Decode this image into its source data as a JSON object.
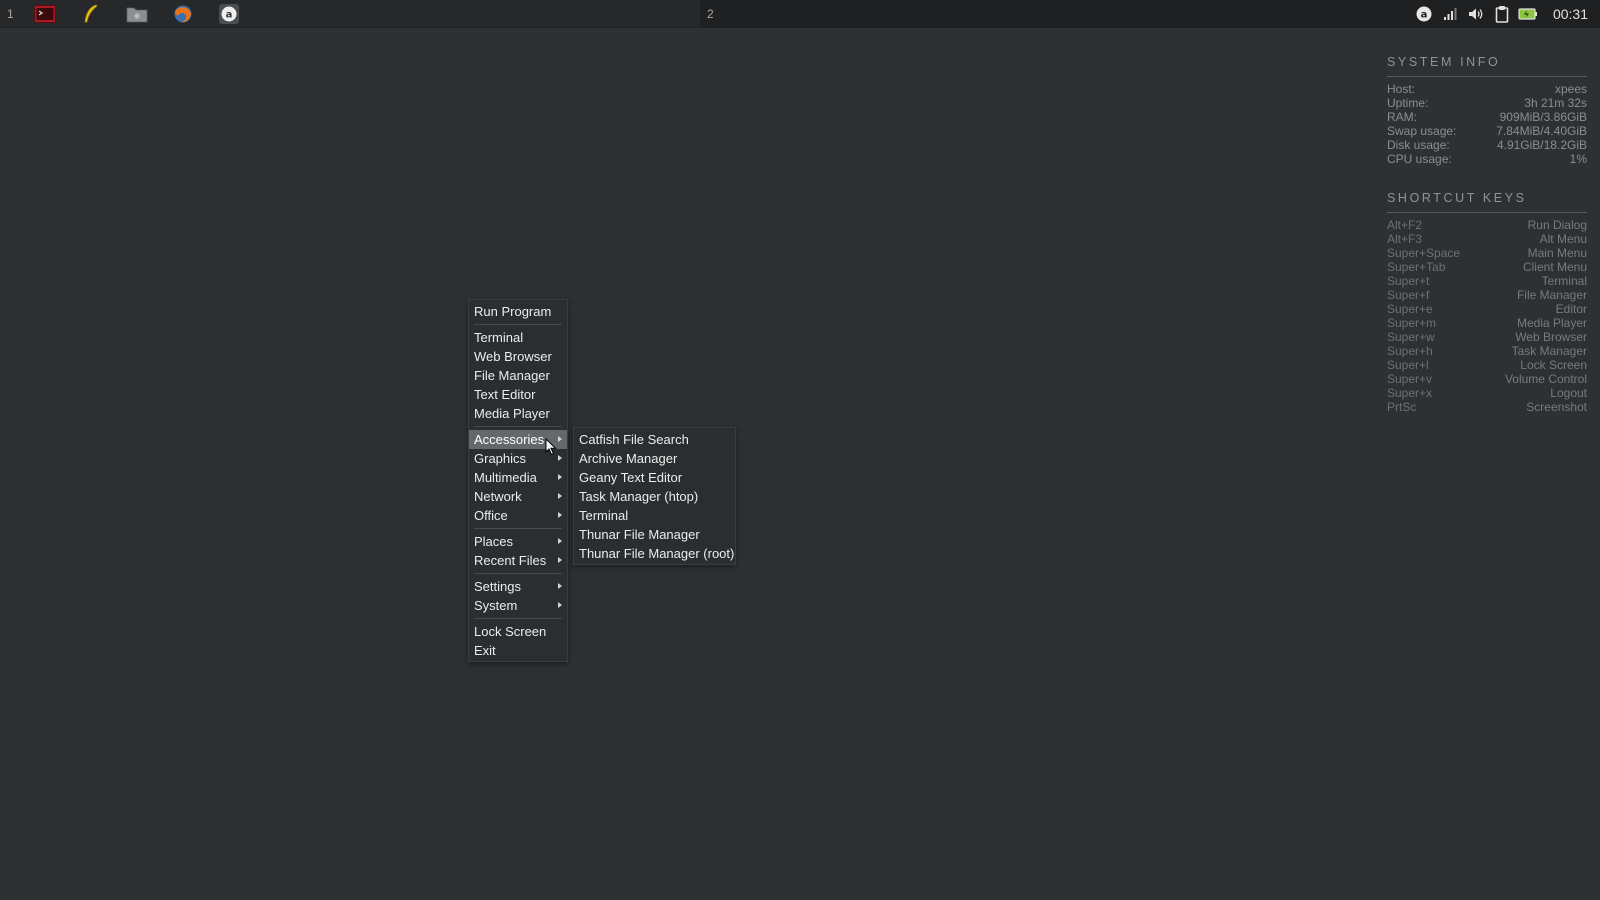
{
  "panel": {
    "workspace_1": "1",
    "workspace_2": "2",
    "launchers": [
      {
        "name": "terminal-launcher",
        "icon": "terminal-icon"
      },
      {
        "name": "editor-launcher",
        "icon": "feather-icon"
      },
      {
        "name": "file-manager-launcher",
        "icon": "folder-icon"
      },
      {
        "name": "browser-launcher",
        "icon": "firefox-icon"
      },
      {
        "name": "app-launcher",
        "icon": "circle-a-icon"
      }
    ],
    "tray": [
      "circle-a-icon",
      "signal-icon",
      "volume-icon",
      "clipboard-icon",
      "battery-icon"
    ],
    "clock": "00:31"
  },
  "conky": {
    "system_title": "SYSTEM INFO",
    "system": [
      {
        "label": "Host:",
        "value": "xpees"
      },
      {
        "label": "Uptime:",
        "value": "3h 21m 32s"
      },
      {
        "label": "RAM:",
        "value": "909MiB/3.86GiB"
      },
      {
        "label": "Swap usage:",
        "value": "7.84MiB/4.40GiB"
      },
      {
        "label": "Disk usage:",
        "value": "4.91GiB/18.2GiB"
      },
      {
        "label": "CPU usage:",
        "value": "1%"
      }
    ],
    "keys_title": "SHORTCUT KEYS",
    "keys": [
      {
        "key": "Alt+F2",
        "action": "Run Dialog"
      },
      {
        "key": "Alt+F3",
        "action": "Alt Menu"
      },
      {
        "key": "Super+Space",
        "action": "Main Menu"
      },
      {
        "key": "Super+Tab",
        "action": "Client Menu"
      },
      {
        "key": "Super+t",
        "action": "Terminal"
      },
      {
        "key": "Super+f",
        "action": "File Manager"
      },
      {
        "key": "Super+e",
        "action": "Editor"
      },
      {
        "key": "Super+m",
        "action": "Media Player"
      },
      {
        "key": "Super+w",
        "action": "Web Browser"
      },
      {
        "key": "Super+h",
        "action": "Task Manager"
      },
      {
        "key": "Super+l",
        "action": "Lock Screen"
      },
      {
        "key": "Super+v",
        "action": "Volume Control"
      },
      {
        "key": "Super+x",
        "action": "Logout"
      },
      {
        "key": "PrtSc",
        "action": "Screenshot"
      }
    ]
  },
  "main_menu": {
    "run_program": "Run Program",
    "terminal": "Terminal",
    "web_browser": "Web Browser",
    "file_manager": "File Manager",
    "text_editor": "Text Editor",
    "media_player": "Media Player",
    "accessories": "Accessories",
    "graphics": "Graphics",
    "multimedia": "Multimedia",
    "network": "Network",
    "office": "Office",
    "places": "Places",
    "recent_files": "Recent Files",
    "settings": "Settings",
    "system": "System",
    "lock_screen": "Lock Screen",
    "exit": "Exit"
  },
  "accessories_menu": {
    "catfish": "Catfish File Search",
    "archive": "Archive Manager",
    "geany": "Geany Text Editor",
    "htop": "Task Manager (htop)",
    "terminal": "Terminal",
    "thunar": "Thunar File Manager",
    "thunar_root": "Thunar File Manager (root)"
  },
  "colors": {
    "desktop": "#2e3133",
    "menu_bg": "#2b2e30",
    "menu_highlight": "#62686c",
    "conky_text": "#8a8e90"
  }
}
